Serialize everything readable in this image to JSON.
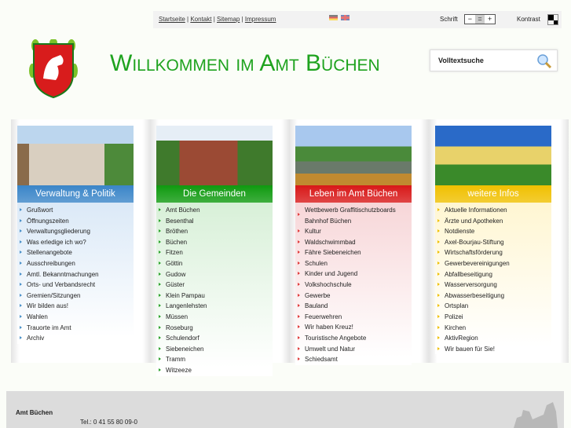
{
  "topbar": {
    "links": [
      "Startseite",
      "Kontakt",
      "Sitemap",
      "Impressum"
    ],
    "schrift_label": "Schrift",
    "font_controls": [
      "−",
      "=",
      "+"
    ],
    "kontrast_label": "Kontrast"
  },
  "header": {
    "title": "Willkommen im Amt Büchen",
    "search_placeholder": "Volltextsuche"
  },
  "columns": [
    {
      "title": "Verwaltung & Politik",
      "color": "#3a85c8",
      "arrow": "#4a90c8",
      "items": [
        "Grußwort",
        "Öffnungszeiten",
        "Verwaltungsgliederung",
        "Was erledige ich wo?",
        "Stellenangebote",
        "Ausschreibungen",
        "Amtl. Bekanntmachungen",
        "Orts- und Verbandsrecht",
        "Gremien/Sitzungen",
        "Wir bilden aus!",
        "Wahlen",
        "Trauorte im Amt",
        "Archiv"
      ]
    },
    {
      "title": "Die Gemeinden",
      "color": "#0f9a0f",
      "arrow": "#2aa12a",
      "items": [
        "Amt Büchen",
        "Besenthal",
        "Bröthen",
        "Büchen",
        "Fitzen",
        "Göttin",
        "Gudow",
        "Güster",
        "Klein Pampau",
        "Langenlehsten",
        "Müssen",
        "Roseburg",
        "Schulendorf",
        "Siebeneichen",
        "Tramm",
        "Witzeeze"
      ]
    },
    {
      "title": "Leben im Amt Büchen",
      "color": "#d81818",
      "arrow": "#e03a3a",
      "items": [
        "Wettbewerb Graffitischutzboards Bahnhof Büchen",
        "Kultur",
        "Waldschwimmbad",
        "Fähre Siebeneichen",
        "Schulen",
        "Kinder und Jugend",
        "Volkshochschule",
        "Gewerbe",
        "Bauland",
        "Feuerwehren",
        "Wir haben Kreuz!",
        "Touristische Angebote",
        "Umwelt und Natur",
        "Schiedsamt"
      ]
    },
    {
      "title": "weitere Infos",
      "color": "#f0c000",
      "arrow": "#f0c000",
      "items": [
        "Aktuelle Informationen",
        "Ärzte und Apotheken",
        "Notdienste",
        "Axel-Bourjau-Stiftung",
        "Wirtschaftsförderung",
        "Gewerbevereinigungen",
        "Abfallbeseitigung",
        "Wasserversorgung",
        "Abwasserbeseitigung",
        "Ortsplan",
        "Polizei",
        "Kirchen",
        "AktivRegion",
        "Wir bauen für Sie!"
      ]
    }
  ],
  "footer": {
    "name": "Amt Büchen",
    "phone": "Tel.: 0 41 55 80 09-0"
  }
}
